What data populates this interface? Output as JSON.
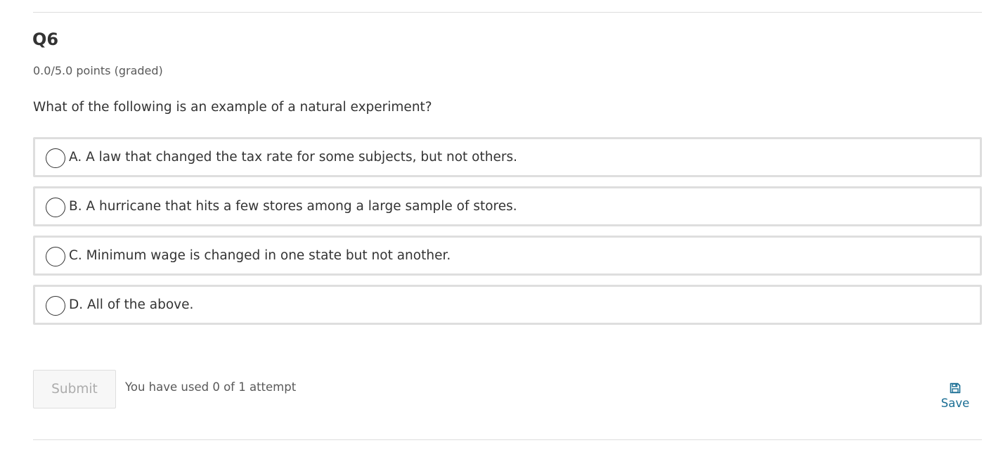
{
  "question": {
    "title": "Q6",
    "points": "0.0/5.0 points (graded)",
    "prompt": "What of the following is an example of a natural experiment?"
  },
  "choices": [
    {
      "label": "A. A law that changed the tax rate for some subjects, but not others.",
      "selected": false
    },
    {
      "label": "B. A hurricane that hits a few stores among a large sample of stores.",
      "selected": false
    },
    {
      "label": "C. Minimum wage is changed in one state but not another.",
      "selected": false
    },
    {
      "label": "D. All of the above.",
      "selected": false
    }
  ],
  "actions": {
    "submit_label": "Submit",
    "attempts_text": "You have used 0 of 1 attempt",
    "save_label": "Save",
    "save_icon": "floppy-disk-icon"
  },
  "colors": {
    "text": "#333333",
    "muted": "#595959",
    "border": "#dedede",
    "link": "#1a6e94",
    "disabled_text": "#acacac"
  }
}
